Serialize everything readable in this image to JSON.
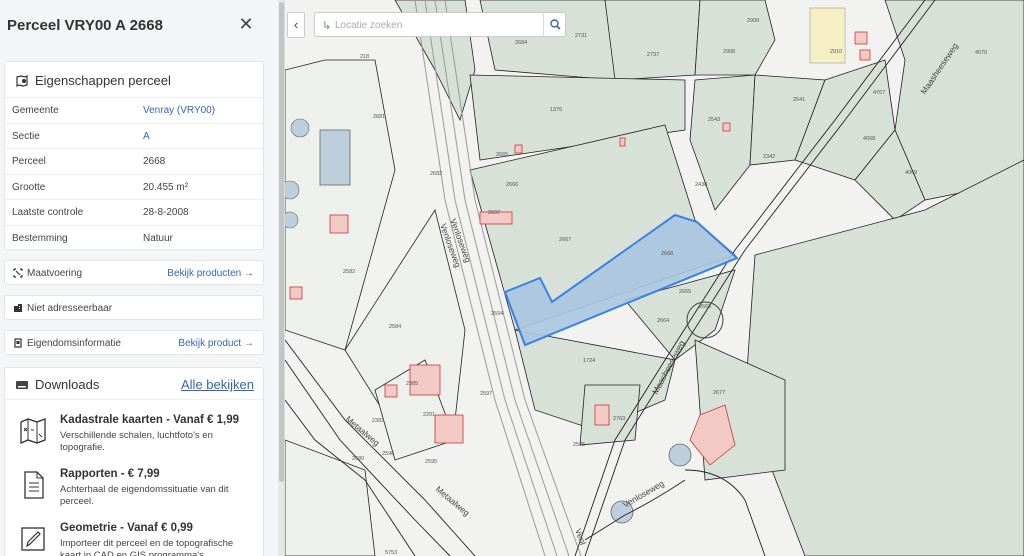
{
  "sidebar": {
    "title": "Perceel VRY00 A 2668",
    "close_icon": "close-icon",
    "properties": {
      "title": "Eigenschappen perceel",
      "icon": "map-marker-icon",
      "rows": [
        {
          "key": "Gemeente",
          "value": "Venray (VRY00)",
          "link": true
        },
        {
          "key": "Sectie",
          "value": "A",
          "link": true
        },
        {
          "key": "Perceel",
          "value": "2668",
          "link": false
        },
        {
          "key": "Grootte",
          "value": "20.455 m²",
          "link": false
        },
        {
          "key": "Laatste controle",
          "value": "28-8-2008",
          "link": false
        },
        {
          "key": "Bestemming",
          "value": "Natuur",
          "link": false
        }
      ]
    },
    "maatvoering": {
      "label": "Maatvoering",
      "action": "Bekijk producten →",
      "icon": "measure-icon"
    },
    "adres": {
      "label": "Niet adresseerbaar",
      "icon": "building-icon"
    },
    "eigendom": {
      "label": "Eigendomsinformatie",
      "action": "Bekijk product →",
      "icon": "document-icon"
    },
    "downloads": {
      "title": "Downloads",
      "icon": "download-box-icon",
      "all_label": "Alle bekijken",
      "items": [
        {
          "title": "Kadastrale kaarten - Vanaf € 1,99",
          "desc": "Verschillende schalen, luchtfoto's en topografie.",
          "icon": "folded-map-icon"
        },
        {
          "title": "Rapporten - € 7,99",
          "desc": "Achterhaal de eigendomssituatie van dit perceel.",
          "icon": "report-icon"
        },
        {
          "title": "Geometrie - Vanaf € 0,99",
          "desc": "Importeer dit perceel en de topografische kaart in CAD en GIS programma's.",
          "icon": "pencil-icon"
        }
      ]
    }
  },
  "map": {
    "search_placeholder": "Locatie zoeken",
    "search_icon": "search-icon",
    "collapse_icon": "chevron-left-icon",
    "selected_parcel": "2668",
    "parcel_labels": [
      "2731",
      "2684",
      "2737",
      "2908",
      "2909",
      "2910",
      "4070",
      "218",
      "2681",
      "1376",
      "2543",
      "2541",
      "4767",
      "2342",
      "4068",
      "4069",
      "2665",
      "2682",
      "2666",
      "2438",
      "2697",
      "2667",
      "2668",
      "2582",
      "2665",
      "2666",
      "2584",
      "2664",
      "2594",
      "1724",
      "2385",
      "2677",
      "2201",
      "2383",
      "2596",
      "2597",
      "2595",
      "2763",
      "2680",
      "2575",
      "5753"
    ],
    "streets": [
      "Maasheeseweg",
      "Venloseweg",
      "Venloseweg",
      "Maasheeseweg",
      "Venloseweg",
      "Metaalweg",
      "Metaalweg",
      "Venl"
    ],
    "colors": {
      "parcel_fill": "#d8e2d8",
      "selected_fill": "#aac6e0",
      "selected_stroke": "#3a82e4",
      "building": "#f2c9c4",
      "building_stroke": "#c43a3a"
    }
  }
}
